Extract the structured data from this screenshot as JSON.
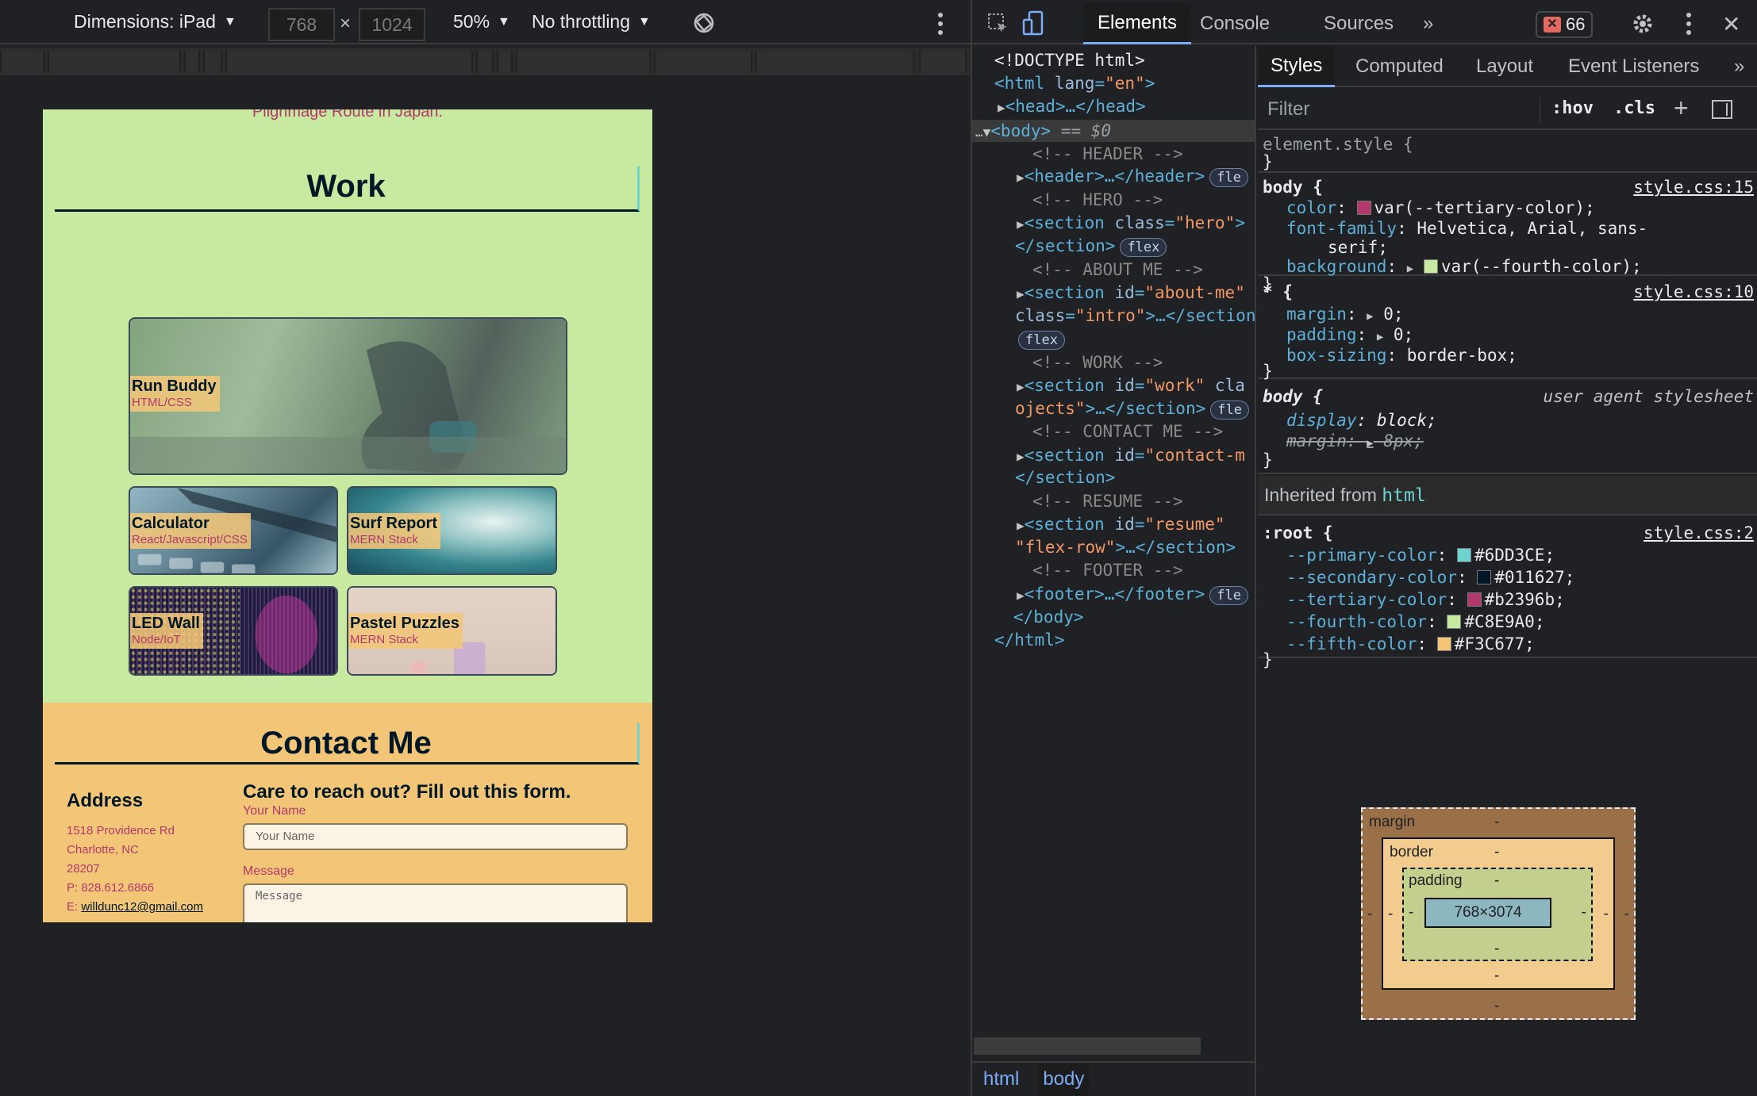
{
  "device_toolbar": {
    "dimensions_label": "Dimensions: iPad",
    "width_value": "768",
    "height_value": "1024",
    "times": "×",
    "zoom": "50%",
    "throttling": "No throttling"
  },
  "viewport": {
    "hero_tail": "Pilgrimage Route in Japan.",
    "work_title": "Work",
    "projects": [
      {
        "title": "Run Buddy",
        "stack": "HTML/CSS"
      },
      {
        "title": "Calculator",
        "stack": "React/Javascript/CSS"
      },
      {
        "title": "Surf Report",
        "stack": "MERN Stack"
      },
      {
        "title": "LED Wall",
        "stack": "Node/IoT"
      },
      {
        "title": "Pastel Puzzles",
        "stack": "MERN Stack"
      }
    ],
    "contact_title": "Contact Me",
    "address": {
      "heading": "Address",
      "line1": "1518 Providence Rd",
      "line2": "Charlotte, NC",
      "line3": "28207",
      "phone": "P: 828.612.6866",
      "email_prefix": "E: ",
      "email": "willdunc12@gmail.com"
    },
    "form": {
      "heading": "Care to reach out? Fill out this form.",
      "name_label": "Your Name",
      "name_placeholder": "Your Name",
      "message_label": "Message",
      "message_placeholder": "Message"
    }
  },
  "devtools": {
    "tabs": [
      "Elements",
      "Console",
      "Sources"
    ],
    "more_tabs": "»",
    "error_count": "66",
    "dom": {
      "doctype": "<!DOCTYPE html>",
      "html_open": "<html",
      "lang_attr": "lang",
      "lang_val": "\"en\"",
      "head": "<head>…</head>",
      "body_open": "<body>",
      "body_marker": "== $0",
      "comment_header": "<!-- HEADER -->",
      "header": "<header>…</header>",
      "comment_hero": "<!-- HERO -->",
      "hero_open": "<section",
      "hero_attr": "class",
      "hero_val": "\"hero\"",
      "hero_close": "</section>",
      "comment_about": "<!-- ABOUT ME -->",
      "about_open": "<section",
      "about_attr": "id",
      "about_val": "\"about-me\"",
      "about_cont_attr": "class",
      "about_cont_val": "\"intro\"",
      "about_close": ">…</section",
      "comment_work": "<!-- WORK -->",
      "work_open": "<section",
      "work_attr": "id",
      "work_val": "\"work\"",
      "work_tail": "cla",
      "work_cont": "ojects\"",
      "work_close": ">…</section>",
      "comment_contact": "<!-- CONTACT ME -->",
      "contact_open": "<section",
      "contact_attr": "id",
      "contact_val": "\"contact-m",
      "contact_close": "</section>",
      "comment_resume": "<!-- RESUME -->",
      "resume_open": "<section",
      "resume_attr": "id",
      "resume_val": "\"resume\"",
      "resume_cont": "\"flex-row\"",
      "resume_close": ">…</section>",
      "comment_footer": "<!-- FOOTER -->",
      "footer": "<footer>…</footer>",
      "body_close": "</body>",
      "html_close": "</html>",
      "pill_flex": "flex",
      "pill_fle": "fle",
      "pill_flex_cut": "flex"
    },
    "breadcrumbs": [
      "html",
      "body"
    ],
    "styles": {
      "subtabs": [
        "Styles",
        "Computed",
        "Layout",
        "Event Listeners"
      ],
      "filter_placeholder": "Filter",
      "hov": ":hov",
      "cls": ".cls",
      "element_style": "element.style {",
      "close_brace": "}",
      "body_rule": {
        "selector": "body {",
        "source": "style.css:15",
        "color_prop": "color",
        "color_val": "var(--tertiary-color);",
        "font_prop": "font-family",
        "font_val": "Helvetica, Arial, sans-",
        "font_val_cont": "serif;",
        "bg_prop": "background",
        "bg_val": "var(--fourth-color);"
      },
      "star_rule": {
        "selector": "* {",
        "source": "style.css:10",
        "margin": "margin",
        "margin_val": "0;",
        "padding": "padding",
        "padding_val": "0;",
        "box_sizing": "box-sizing",
        "box_sizing_val": "border-box;"
      },
      "ua_rule": {
        "selector": "body {",
        "source": "user agent stylesheet",
        "display": "display",
        "display_val": "block;",
        "margin": "margin",
        "margin_val": "8px;"
      },
      "inherited_label": "Inherited from",
      "inherited_from": "html",
      "root_rule": {
        "selector": ":root {",
        "source": "style.css:2",
        "vars": [
          {
            "name": "--primary-color",
            "value": "#6DD3CE;",
            "color": "#6DD3CE"
          },
          {
            "name": "--secondary-color",
            "value": "#011627;",
            "color": "#011627"
          },
          {
            "name": "--tertiary-color",
            "value": "#b2396b;",
            "color": "#b2396b"
          },
          {
            "name": "--fourth-color",
            "value": "#C8E9A0;",
            "color": "#C8E9A0"
          },
          {
            "name": "--fifth-color",
            "value": "#F3C677;",
            "color": "#F3C677"
          }
        ]
      },
      "box_model": {
        "margin_label": "margin",
        "border_label": "border",
        "padding_label": "padding",
        "content": "768×3074",
        "dash": "-"
      }
    }
  },
  "colors": {
    "primary": "#6DD3CE",
    "secondary": "#011627",
    "tertiary": "#b2396b",
    "fourth": "#C8E9A0",
    "fifth": "#F3C677",
    "devtools_bg": "#202124",
    "accent_blue": "#7cacf8"
  }
}
